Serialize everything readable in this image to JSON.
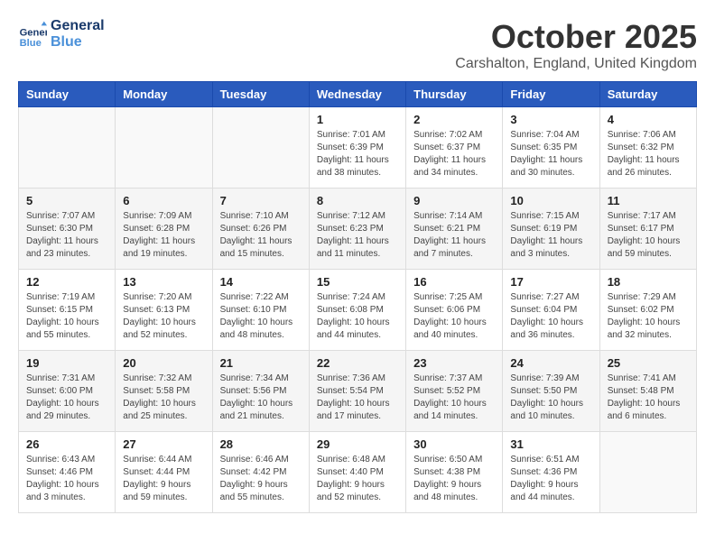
{
  "header": {
    "logo_line1": "General",
    "logo_line2": "Blue",
    "month": "October 2025",
    "location": "Carshalton, England, United Kingdom"
  },
  "weekdays": [
    "Sunday",
    "Monday",
    "Tuesday",
    "Wednesday",
    "Thursday",
    "Friday",
    "Saturday"
  ],
  "weeks": [
    [
      {
        "day": "",
        "info": ""
      },
      {
        "day": "",
        "info": ""
      },
      {
        "day": "",
        "info": ""
      },
      {
        "day": "1",
        "info": "Sunrise: 7:01 AM\nSunset: 6:39 PM\nDaylight: 11 hours\nand 38 minutes."
      },
      {
        "day": "2",
        "info": "Sunrise: 7:02 AM\nSunset: 6:37 PM\nDaylight: 11 hours\nand 34 minutes."
      },
      {
        "day": "3",
        "info": "Sunrise: 7:04 AM\nSunset: 6:35 PM\nDaylight: 11 hours\nand 30 minutes."
      },
      {
        "day": "4",
        "info": "Sunrise: 7:06 AM\nSunset: 6:32 PM\nDaylight: 11 hours\nand 26 minutes."
      }
    ],
    [
      {
        "day": "5",
        "info": "Sunrise: 7:07 AM\nSunset: 6:30 PM\nDaylight: 11 hours\nand 23 minutes."
      },
      {
        "day": "6",
        "info": "Sunrise: 7:09 AM\nSunset: 6:28 PM\nDaylight: 11 hours\nand 19 minutes."
      },
      {
        "day": "7",
        "info": "Sunrise: 7:10 AM\nSunset: 6:26 PM\nDaylight: 11 hours\nand 15 minutes."
      },
      {
        "day": "8",
        "info": "Sunrise: 7:12 AM\nSunset: 6:23 PM\nDaylight: 11 hours\nand 11 minutes."
      },
      {
        "day": "9",
        "info": "Sunrise: 7:14 AM\nSunset: 6:21 PM\nDaylight: 11 hours\nand 7 minutes."
      },
      {
        "day": "10",
        "info": "Sunrise: 7:15 AM\nSunset: 6:19 PM\nDaylight: 11 hours\nand 3 minutes."
      },
      {
        "day": "11",
        "info": "Sunrise: 7:17 AM\nSunset: 6:17 PM\nDaylight: 10 hours\nand 59 minutes."
      }
    ],
    [
      {
        "day": "12",
        "info": "Sunrise: 7:19 AM\nSunset: 6:15 PM\nDaylight: 10 hours\nand 55 minutes."
      },
      {
        "day": "13",
        "info": "Sunrise: 7:20 AM\nSunset: 6:13 PM\nDaylight: 10 hours\nand 52 minutes."
      },
      {
        "day": "14",
        "info": "Sunrise: 7:22 AM\nSunset: 6:10 PM\nDaylight: 10 hours\nand 48 minutes."
      },
      {
        "day": "15",
        "info": "Sunrise: 7:24 AM\nSunset: 6:08 PM\nDaylight: 10 hours\nand 44 minutes."
      },
      {
        "day": "16",
        "info": "Sunrise: 7:25 AM\nSunset: 6:06 PM\nDaylight: 10 hours\nand 40 minutes."
      },
      {
        "day": "17",
        "info": "Sunrise: 7:27 AM\nSunset: 6:04 PM\nDaylight: 10 hours\nand 36 minutes."
      },
      {
        "day": "18",
        "info": "Sunrise: 7:29 AM\nSunset: 6:02 PM\nDaylight: 10 hours\nand 32 minutes."
      }
    ],
    [
      {
        "day": "19",
        "info": "Sunrise: 7:31 AM\nSunset: 6:00 PM\nDaylight: 10 hours\nand 29 minutes."
      },
      {
        "day": "20",
        "info": "Sunrise: 7:32 AM\nSunset: 5:58 PM\nDaylight: 10 hours\nand 25 minutes."
      },
      {
        "day": "21",
        "info": "Sunrise: 7:34 AM\nSunset: 5:56 PM\nDaylight: 10 hours\nand 21 minutes."
      },
      {
        "day": "22",
        "info": "Sunrise: 7:36 AM\nSunset: 5:54 PM\nDaylight: 10 hours\nand 17 minutes."
      },
      {
        "day": "23",
        "info": "Sunrise: 7:37 AM\nSunset: 5:52 PM\nDaylight: 10 hours\nand 14 minutes."
      },
      {
        "day": "24",
        "info": "Sunrise: 7:39 AM\nSunset: 5:50 PM\nDaylight: 10 hours\nand 10 minutes."
      },
      {
        "day": "25",
        "info": "Sunrise: 7:41 AM\nSunset: 5:48 PM\nDaylight: 10 hours\nand 6 minutes."
      }
    ],
    [
      {
        "day": "26",
        "info": "Sunrise: 6:43 AM\nSunset: 4:46 PM\nDaylight: 10 hours\nand 3 minutes."
      },
      {
        "day": "27",
        "info": "Sunrise: 6:44 AM\nSunset: 4:44 PM\nDaylight: 9 hours\nand 59 minutes."
      },
      {
        "day": "28",
        "info": "Sunrise: 6:46 AM\nSunset: 4:42 PM\nDaylight: 9 hours\nand 55 minutes."
      },
      {
        "day": "29",
        "info": "Sunrise: 6:48 AM\nSunset: 4:40 PM\nDaylight: 9 hours\nand 52 minutes."
      },
      {
        "day": "30",
        "info": "Sunrise: 6:50 AM\nSunset: 4:38 PM\nDaylight: 9 hours\nand 48 minutes."
      },
      {
        "day": "31",
        "info": "Sunrise: 6:51 AM\nSunset: 4:36 PM\nDaylight: 9 hours\nand 44 minutes."
      },
      {
        "day": "",
        "info": ""
      }
    ]
  ]
}
